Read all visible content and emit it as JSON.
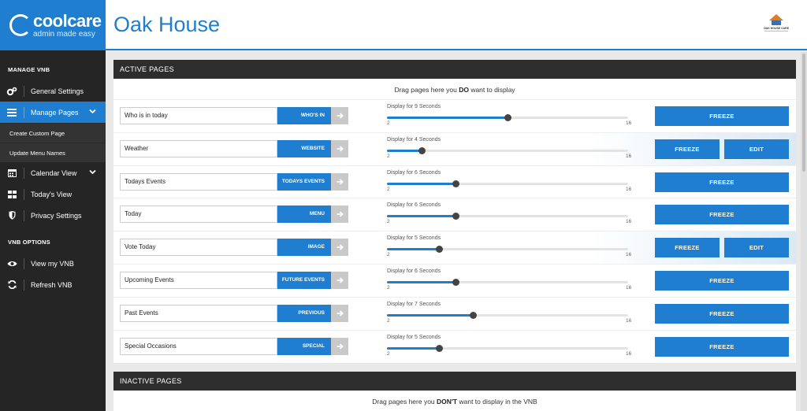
{
  "brand": {
    "name": "coolcare",
    "tagline": "admin made easy"
  },
  "header": {
    "title": "Oak House",
    "logo_text": "OAK HOUSE CARE"
  },
  "sidebar": {
    "section1": "MANAGE VNB",
    "general_settings": "General Settings",
    "manage_pages": "Manage Pages",
    "create_custom_page": "Create Custom Page",
    "update_menu_names": "Update Menu Names",
    "calendar_view": "Calendar View",
    "todays_view": "Today's View",
    "privacy_settings": "Privacy Settings",
    "section2": "VNB OPTIONS",
    "view_my_vnb": "View my VNB",
    "refresh_vnb": "Refresh VNB"
  },
  "active": {
    "heading": "ACTIVE PAGES",
    "hint_pre": "Drag pages here you ",
    "hint_bold": "DO",
    "hint_post": " want to display"
  },
  "inactive": {
    "heading": "INACTIVE PAGES",
    "hint_pre": "Drag pages here you ",
    "hint_bold": "DON'T",
    "hint_post": " want to display in the VNB"
  },
  "slider": {
    "min": 2,
    "max": 16,
    "min_label": "2",
    "max_label": "16"
  },
  "freeze_label": "FREEZE",
  "edit_label": "EDIT",
  "rows": [
    {
      "name": "Who is in today",
      "type": "WHO'S IN",
      "display": "Display for 9 Seconds",
      "seconds": 9,
      "editable": false
    },
    {
      "name": "Weather",
      "type": "WEBSITE",
      "display": "Display for 4 Seconds",
      "seconds": 4,
      "editable": true
    },
    {
      "name": "Todays Events",
      "type": "TODAYS EVENTS",
      "display": "Display for 6 Seconds",
      "seconds": 6,
      "editable": false
    },
    {
      "name": "Today",
      "type": "MENU",
      "display": "Display for 6 Seconds",
      "seconds": 6,
      "editable": false
    },
    {
      "name": "Vote Today",
      "type": "IMAGE",
      "display": "Display for 5 Seconds",
      "seconds": 5,
      "editable": true
    },
    {
      "name": "Upcoming Events",
      "type": "FUTURE EVENTS",
      "display": "Display for 6 Seconds",
      "seconds": 6,
      "editable": false
    },
    {
      "name": "Past Events",
      "type": "PREVIOUS EVENTS",
      "display": "Display for 7 Seconds",
      "seconds": 7,
      "editable": false
    },
    {
      "name": "Special Occasions",
      "type": "SPECIAL",
      "display": "Display for 5 Seconds",
      "seconds": 5,
      "editable": false
    }
  ],
  "colors": {
    "accent": "#1f7ed0",
    "sidebar": "#252525",
    "panel_head": "#2d2d2d"
  },
  "icons": {
    "general_settings": "gears-icon",
    "manage_pages": "list-icon",
    "calendar_view": "calendar-icon",
    "todays_view": "grid-icon",
    "privacy_settings": "shield-icon",
    "view_my_vnb": "eye-icon",
    "refresh_vnb": "refresh-icon",
    "row_action": "arrow-right-icon"
  }
}
